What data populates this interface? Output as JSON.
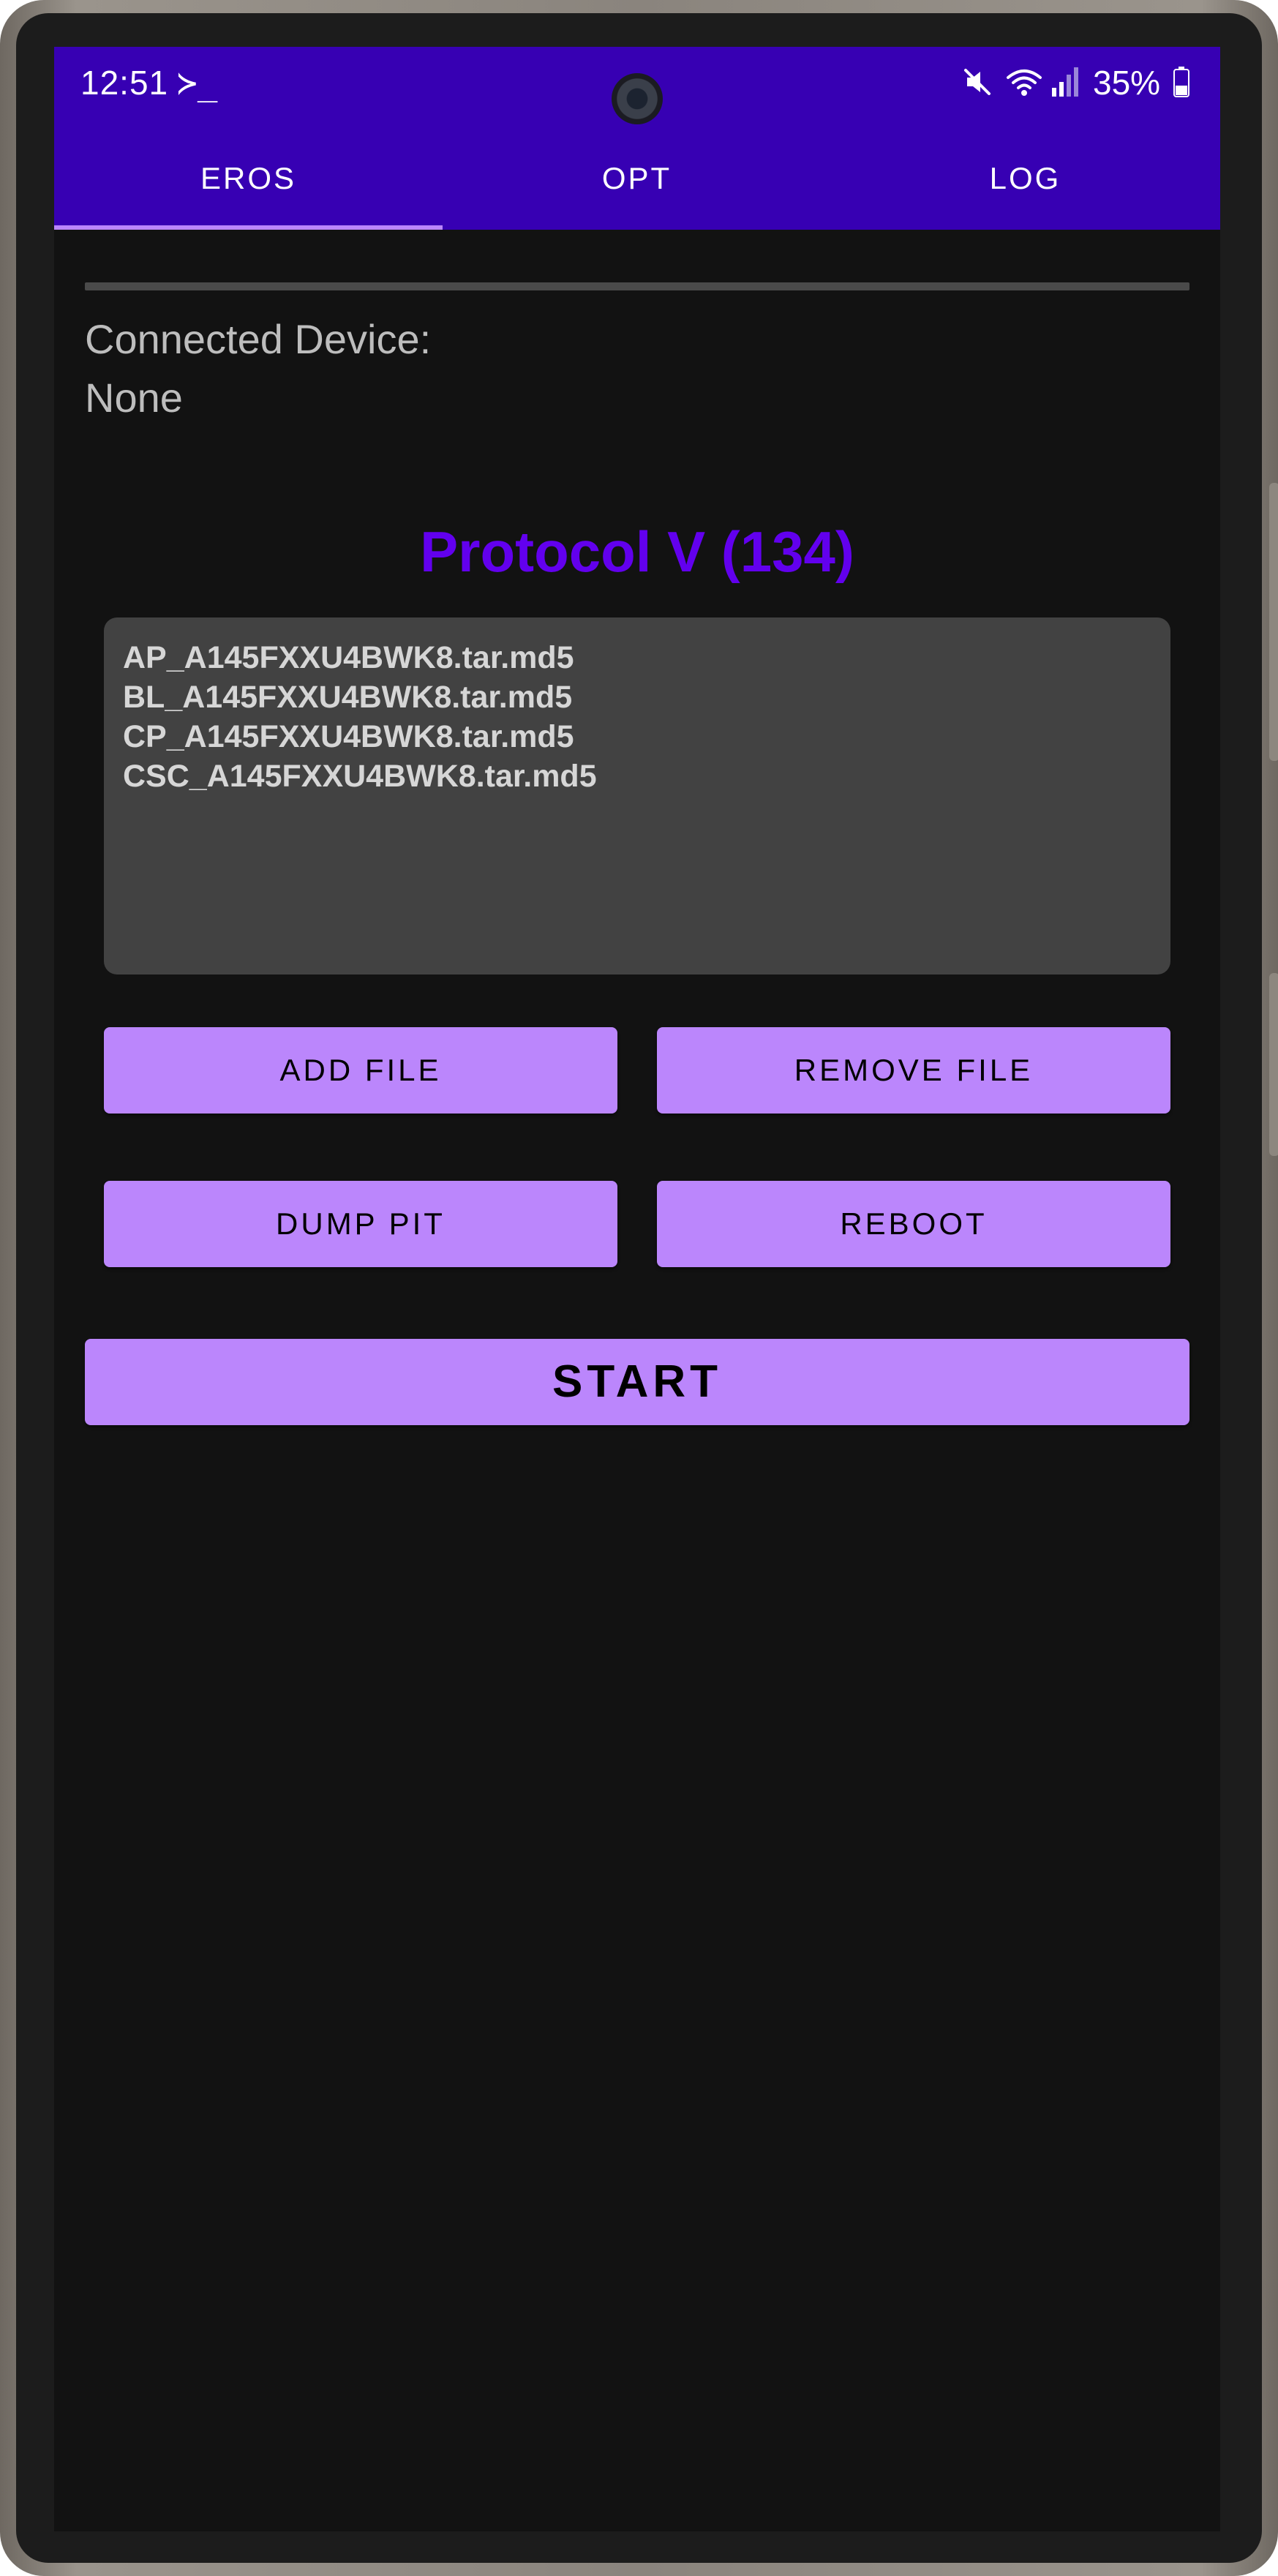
{
  "status_bar": {
    "time": "12:51",
    "terminal_glyph": "≻_",
    "battery": "35%",
    "icons": [
      "mute-icon",
      "wifi-icon",
      "signal-icon",
      "battery-icon"
    ]
  },
  "tabs": [
    {
      "label": "EROS",
      "selected": true
    },
    {
      "label": "OPT",
      "selected": false
    },
    {
      "label": "LOG",
      "selected": false
    }
  ],
  "progress": {
    "value": 0
  },
  "connection": {
    "label": "Connected Device:",
    "value": "None"
  },
  "protocol": {
    "title": "Protocol V (134)"
  },
  "files": [
    "AP_A145FXXU4BWK8.tar.md5",
    "BL_A145FXXU4BWK8.tar.md5",
    "CP_A145FXXU4BWK8.tar.md5",
    "CSC_A145FXXU4BWK8.tar.md5"
  ],
  "buttons": {
    "add_file": "ADD FILE",
    "remove_file": "REMOVE FILE",
    "dump_pit": "DUMP PIT",
    "reboot": "REBOOT",
    "start": "START"
  },
  "colors": {
    "app_bar": "#3700b3",
    "accent": "#bb86fc",
    "protocol_title": "#6200ee",
    "background": "#121212",
    "file_box": "#424242"
  }
}
